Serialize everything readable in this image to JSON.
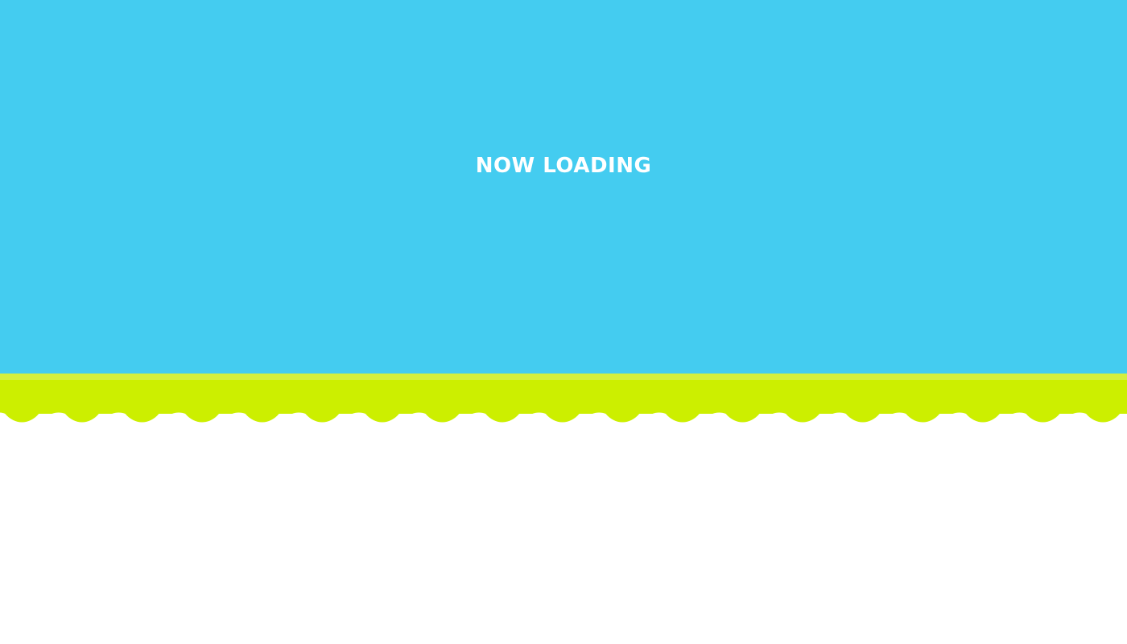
{
  "loading": {
    "text": "NOW LOADING"
  },
  "colors": {
    "sky": "#44ccf0",
    "accent_line": "#d4ef3e",
    "scallop": "#ccef00",
    "page": "#ffffff",
    "text": "#ffffff"
  }
}
